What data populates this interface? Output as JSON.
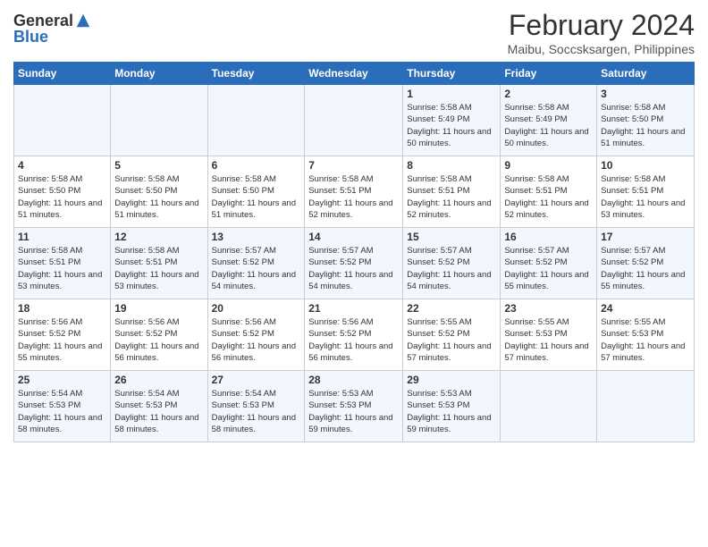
{
  "logo": {
    "general": "General",
    "blue": "Blue"
  },
  "title": "February 2024",
  "location": "Maibu, Soccsksargen, Philippines",
  "days_of_week": [
    "Sunday",
    "Monday",
    "Tuesday",
    "Wednesday",
    "Thursday",
    "Friday",
    "Saturday"
  ],
  "weeks": [
    [
      {
        "day": "",
        "info": ""
      },
      {
        "day": "",
        "info": ""
      },
      {
        "day": "",
        "info": ""
      },
      {
        "day": "",
        "info": ""
      },
      {
        "day": "1",
        "info": "Sunrise: 5:58 AM\nSunset: 5:49 PM\nDaylight: 11 hours and 50 minutes."
      },
      {
        "day": "2",
        "info": "Sunrise: 5:58 AM\nSunset: 5:49 PM\nDaylight: 11 hours and 50 minutes."
      },
      {
        "day": "3",
        "info": "Sunrise: 5:58 AM\nSunset: 5:50 PM\nDaylight: 11 hours and 51 minutes."
      }
    ],
    [
      {
        "day": "4",
        "info": "Sunrise: 5:58 AM\nSunset: 5:50 PM\nDaylight: 11 hours and 51 minutes."
      },
      {
        "day": "5",
        "info": "Sunrise: 5:58 AM\nSunset: 5:50 PM\nDaylight: 11 hours and 51 minutes."
      },
      {
        "day": "6",
        "info": "Sunrise: 5:58 AM\nSunset: 5:50 PM\nDaylight: 11 hours and 51 minutes."
      },
      {
        "day": "7",
        "info": "Sunrise: 5:58 AM\nSunset: 5:51 PM\nDaylight: 11 hours and 52 minutes."
      },
      {
        "day": "8",
        "info": "Sunrise: 5:58 AM\nSunset: 5:51 PM\nDaylight: 11 hours and 52 minutes."
      },
      {
        "day": "9",
        "info": "Sunrise: 5:58 AM\nSunset: 5:51 PM\nDaylight: 11 hours and 52 minutes."
      },
      {
        "day": "10",
        "info": "Sunrise: 5:58 AM\nSunset: 5:51 PM\nDaylight: 11 hours and 53 minutes."
      }
    ],
    [
      {
        "day": "11",
        "info": "Sunrise: 5:58 AM\nSunset: 5:51 PM\nDaylight: 11 hours and 53 minutes."
      },
      {
        "day": "12",
        "info": "Sunrise: 5:58 AM\nSunset: 5:51 PM\nDaylight: 11 hours and 53 minutes."
      },
      {
        "day": "13",
        "info": "Sunrise: 5:57 AM\nSunset: 5:52 PM\nDaylight: 11 hours and 54 minutes."
      },
      {
        "day": "14",
        "info": "Sunrise: 5:57 AM\nSunset: 5:52 PM\nDaylight: 11 hours and 54 minutes."
      },
      {
        "day": "15",
        "info": "Sunrise: 5:57 AM\nSunset: 5:52 PM\nDaylight: 11 hours and 54 minutes."
      },
      {
        "day": "16",
        "info": "Sunrise: 5:57 AM\nSunset: 5:52 PM\nDaylight: 11 hours and 55 minutes."
      },
      {
        "day": "17",
        "info": "Sunrise: 5:57 AM\nSunset: 5:52 PM\nDaylight: 11 hours and 55 minutes."
      }
    ],
    [
      {
        "day": "18",
        "info": "Sunrise: 5:56 AM\nSunset: 5:52 PM\nDaylight: 11 hours and 55 minutes."
      },
      {
        "day": "19",
        "info": "Sunrise: 5:56 AM\nSunset: 5:52 PM\nDaylight: 11 hours and 56 minutes."
      },
      {
        "day": "20",
        "info": "Sunrise: 5:56 AM\nSunset: 5:52 PM\nDaylight: 11 hours and 56 minutes."
      },
      {
        "day": "21",
        "info": "Sunrise: 5:56 AM\nSunset: 5:52 PM\nDaylight: 11 hours and 56 minutes."
      },
      {
        "day": "22",
        "info": "Sunrise: 5:55 AM\nSunset: 5:52 PM\nDaylight: 11 hours and 57 minutes."
      },
      {
        "day": "23",
        "info": "Sunrise: 5:55 AM\nSunset: 5:53 PM\nDaylight: 11 hours and 57 minutes."
      },
      {
        "day": "24",
        "info": "Sunrise: 5:55 AM\nSunset: 5:53 PM\nDaylight: 11 hours and 57 minutes."
      }
    ],
    [
      {
        "day": "25",
        "info": "Sunrise: 5:54 AM\nSunset: 5:53 PM\nDaylight: 11 hours and 58 minutes."
      },
      {
        "day": "26",
        "info": "Sunrise: 5:54 AM\nSunset: 5:53 PM\nDaylight: 11 hours and 58 minutes."
      },
      {
        "day": "27",
        "info": "Sunrise: 5:54 AM\nSunset: 5:53 PM\nDaylight: 11 hours and 58 minutes."
      },
      {
        "day": "28",
        "info": "Sunrise: 5:53 AM\nSunset: 5:53 PM\nDaylight: 11 hours and 59 minutes."
      },
      {
        "day": "29",
        "info": "Sunrise: 5:53 AM\nSunset: 5:53 PM\nDaylight: 11 hours and 59 minutes."
      },
      {
        "day": "",
        "info": ""
      },
      {
        "day": "",
        "info": ""
      }
    ]
  ]
}
